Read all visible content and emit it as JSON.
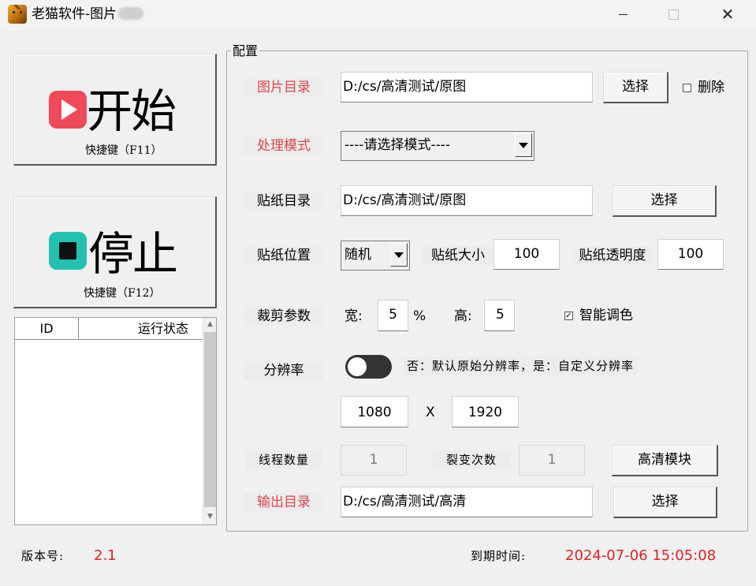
{
  "window": {
    "title": "老猫软件-图片",
    "app_icon": "cat-icon",
    "controls": {
      "minimize": "minimize-icon",
      "maximize": "maximize-icon",
      "close": "close-icon"
    }
  },
  "left_panel": {
    "start_button": {
      "label": "开始",
      "hotkey": "快捷键（F11）",
      "icon": "play-icon",
      "icon_color": "#f04a5a"
    },
    "stop_button": {
      "label": "停止",
      "hotkey": "快捷键（F12）",
      "icon": "stop-icon",
      "icon_color": "#22c1b0"
    },
    "list": {
      "columns": [
        "ID",
        "运行状态"
      ],
      "rows": []
    }
  },
  "config": {
    "group_label": "配置",
    "image_dir": {
      "label": "图片目录",
      "value": "D:/cs/高清测试/原图",
      "button": "选择"
    },
    "delete_checkbox": {
      "label": "删除",
      "checked": false
    },
    "mode": {
      "label": "处理模式",
      "selected": "----请选择模式----"
    },
    "sticker_dir": {
      "label": "贴纸目录",
      "value": "D:/cs/高清测试/原图",
      "button": "选择"
    },
    "sticker_pos": {
      "label": "贴纸位置",
      "selected": "随机"
    },
    "sticker_size": {
      "label": "贴纸大小",
      "value": "100"
    },
    "sticker_opacity": {
      "label": "贴纸透明度",
      "value": "100"
    },
    "crop": {
      "label": "裁剪参数",
      "width_label": "宽:",
      "width_value": "5",
      "percent": "%",
      "height_label": "高:",
      "height_value": "5"
    },
    "smart_color": {
      "label": "智能调色",
      "checked": true
    },
    "resolution": {
      "label": "分辨率",
      "toggle_on": false,
      "hint": "否：默认原始分辨率，是：自定义分辨率",
      "width": "1080",
      "x": "X",
      "height": "1920"
    },
    "threads": {
      "label": "线程数量",
      "value": "1"
    },
    "fission": {
      "label": "裂变次数",
      "value": "1"
    },
    "hd_button": "高清模块",
    "output_dir": {
      "label": "输出目录",
      "value": "D:/cs/高清测试/高清",
      "button": "选择"
    }
  },
  "footer": {
    "version_label": "版本号:",
    "version_value": "2.1",
    "expiry_label": "到期时间:",
    "expiry_value": "2024-07-06 15:05:08"
  },
  "colors": {
    "accent_red": "#d9474b",
    "expiry_red": "#e02222",
    "background": "#f0f0f0"
  }
}
